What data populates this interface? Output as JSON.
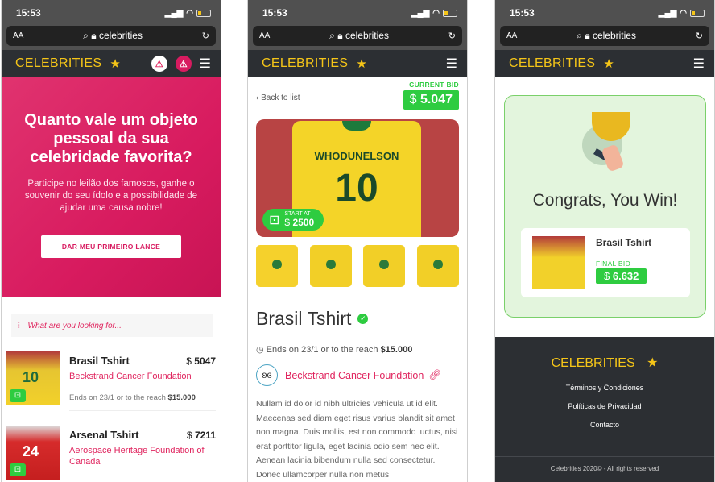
{
  "status": {
    "time": "15:53"
  },
  "browser": {
    "aa": "AA",
    "url": "celebrities"
  },
  "brand": {
    "logo": "CELEBRITIES",
    "star": "★",
    "menu": "☰",
    "alert": "⚠"
  },
  "home": {
    "hero_title": "Quanto vale um objeto pessoal da sua celebridade favorita?",
    "hero_text": "Participe no leilão dos famosos, ganhe o souvenir do seu ídolo e a possibilidade de ajudar uma causa nobre!",
    "cta": "DAR MEU PRIMEIRO LANCE",
    "search_placeholder": "What are you looking for...",
    "items": [
      {
        "name": "Brasil Tshirt",
        "currency": "$",
        "price": "5047",
        "foundation": "Beckstrand Cancer Foundation",
        "ends_prefix": "Ends on 23/1 or to the reach",
        "ends_amount": "$15.000",
        "thumb_num": "10"
      },
      {
        "name": "Arsenal Tshirt",
        "currency": "$",
        "price": "7211",
        "foundation": "Aerospace Heritage Foundation of Canada",
        "thumb_num": "24"
      }
    ]
  },
  "detail": {
    "back": "Back to list",
    "current_bid_label": "CURRENT BID",
    "current_bid_currency": "$",
    "current_bid": "5.047",
    "shirt_name": "WHODUNELSON",
    "shirt_number": "10",
    "start_label": "START AT",
    "start_currency": "$",
    "start_value": "2500",
    "title": "Brasil Tshirt",
    "ends_prefix": "Ends on 23/1 or to the reach",
    "ends_amount": "$15.000",
    "foundation": "Beckstrand Cancer Foundation",
    "description": "Nullam id dolor id nibh ultricies vehicula ut id elit. Maecenas sed diam eget risus varius blandit sit amet non magna. Duis mollis, est non commodo luctus, nisi erat porttitor ligula, eget lacinia odio sem nec elit. Aenean lacinia bibendum nulla sed consectetur. Donec ullamcorper nulla non metus"
  },
  "win": {
    "congrats": "Congrats, You Win!",
    "item_name": "Brasil Tshirt",
    "final_label": "FINAL BID",
    "final_currency": "$",
    "final_value": "6.632",
    "footer_links": [
      "Términos y Condiciones",
      "Políticas de Privacidad",
      "Contacto"
    ],
    "copyright": "Celebrities 2020© - All rights reserved"
  },
  "colors": {
    "accent": "#f5c518",
    "pink": "#d81b60",
    "green": "#2ecc40",
    "dark": "#2c2f33"
  }
}
